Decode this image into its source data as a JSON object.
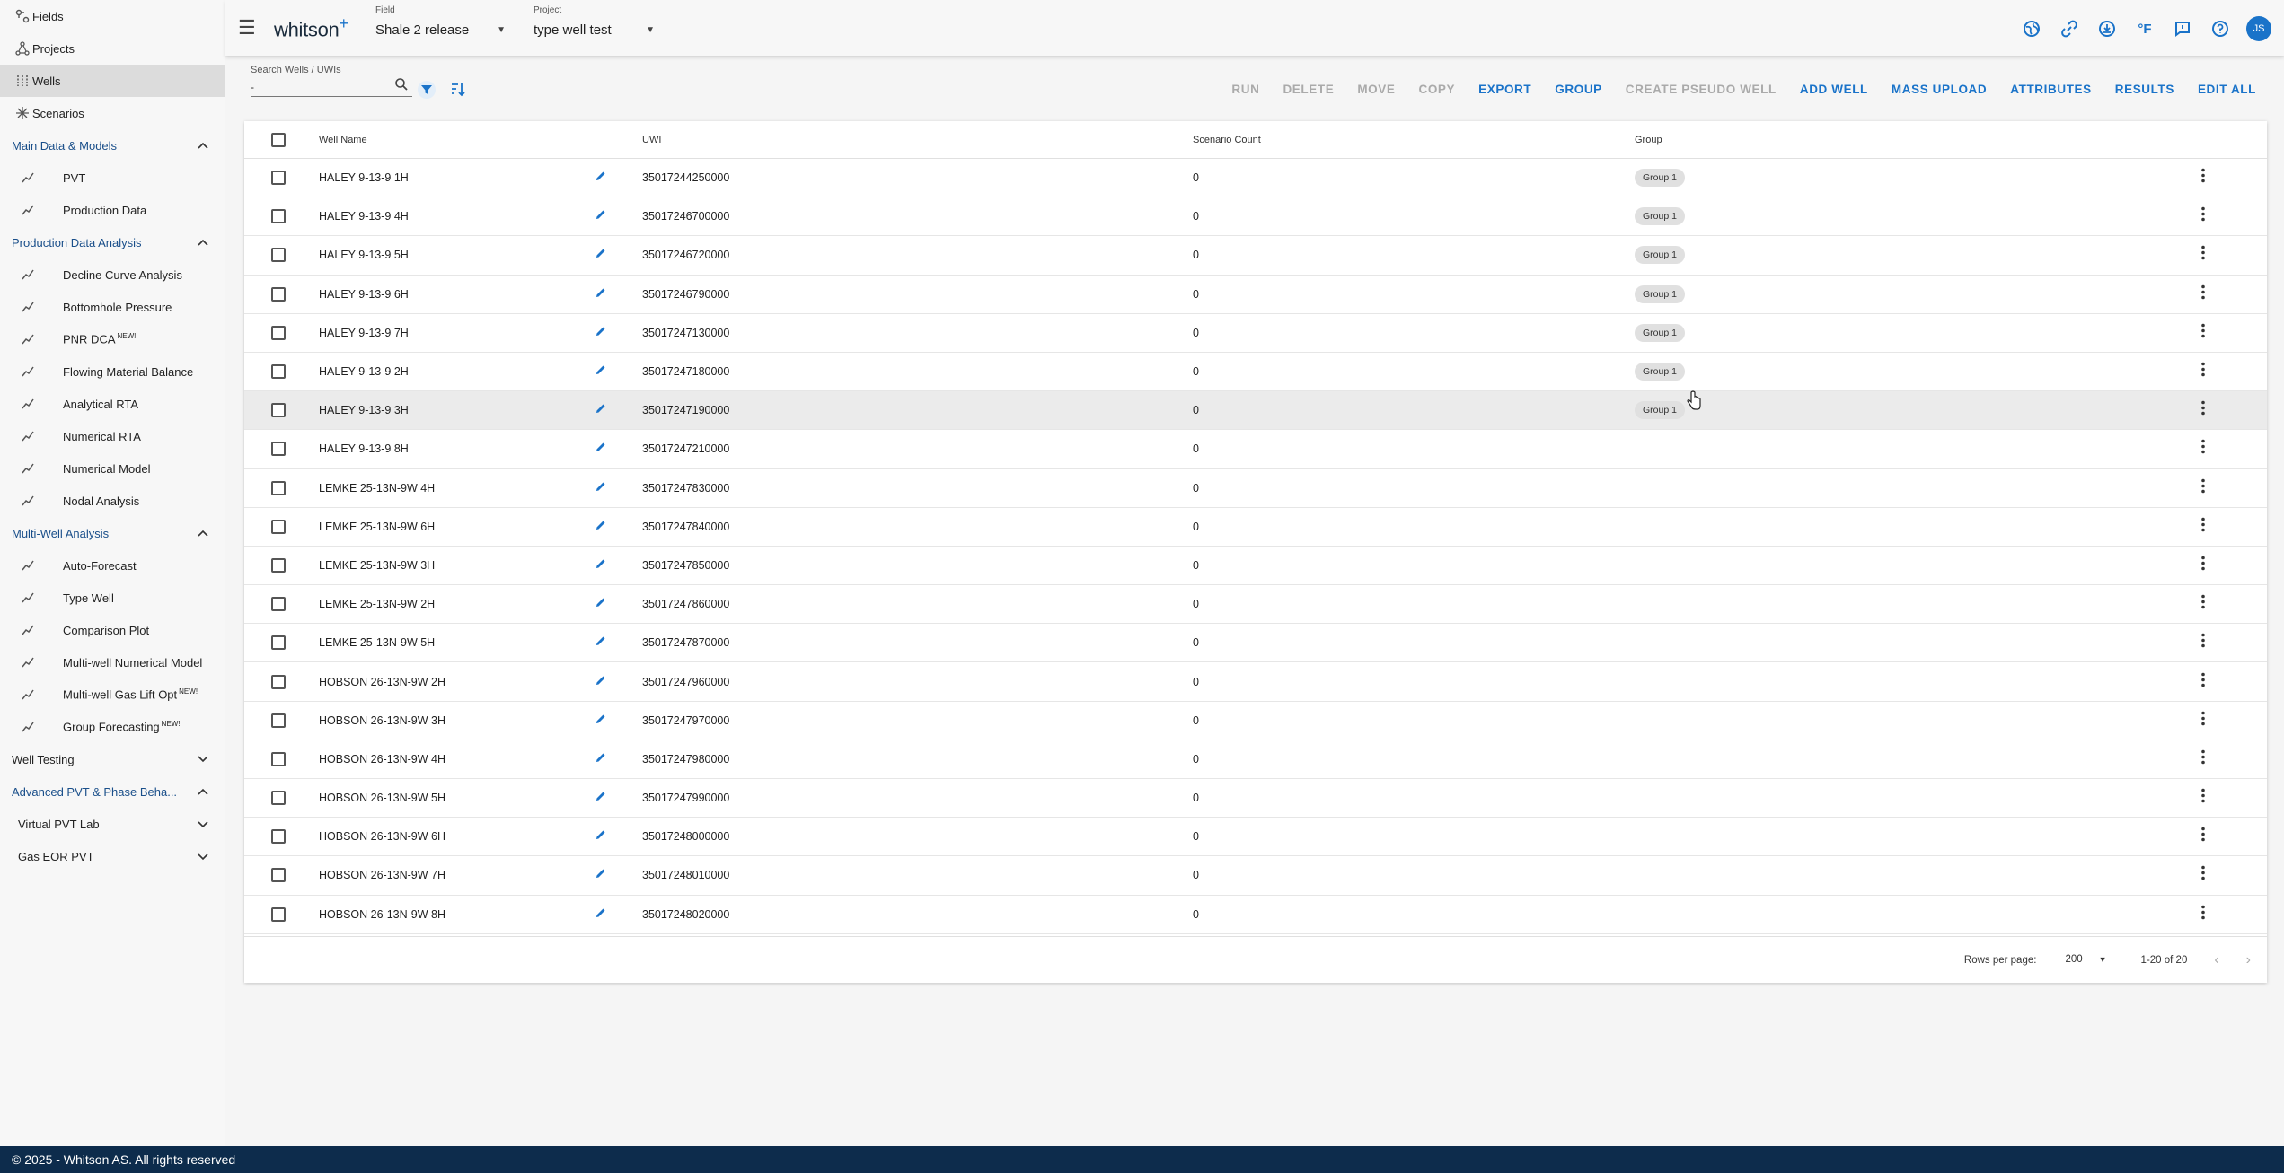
{
  "sidebar": {
    "top_items": [
      {
        "label": "Fields",
        "icon": "fields-icon"
      },
      {
        "label": "Projects",
        "icon": "projects-icon"
      },
      {
        "label": "Wells",
        "icon": "wells-icon",
        "active": true
      },
      {
        "label": "Scenarios",
        "icon": "scenarios-icon"
      }
    ],
    "sections": [
      {
        "title": "Main Data & Models",
        "expanded": true,
        "items": [
          {
            "label": "PVT",
            "new": false
          },
          {
            "label": "Production Data",
            "new": false
          }
        ]
      },
      {
        "title": "Production Data Analysis",
        "expanded": true,
        "items": [
          {
            "label": "Decline Curve Analysis",
            "new": false
          },
          {
            "label": "Bottomhole Pressure",
            "new": false
          },
          {
            "label": "PNR DCA",
            "new": true
          },
          {
            "label": "Flowing Material Balance",
            "new": false
          },
          {
            "label": "Analytical RTA",
            "new": false
          },
          {
            "label": "Numerical RTA",
            "new": false
          },
          {
            "label": "Numerical Model",
            "new": false
          },
          {
            "label": "Nodal Analysis",
            "new": false
          }
        ]
      },
      {
        "title": "Multi-Well Analysis",
        "expanded": true,
        "items": [
          {
            "label": "Auto-Forecast",
            "new": false
          },
          {
            "label": "Type Well",
            "new": false
          },
          {
            "label": "Comparison Plot",
            "new": false
          },
          {
            "label": "Multi-well Numerical Model",
            "new": false
          },
          {
            "label": "Multi-well Gas Lift Opt",
            "new": true
          },
          {
            "label": "Group Forecasting",
            "new": true
          }
        ]
      }
    ],
    "well_testing": "Well Testing",
    "advanced": "Advanced PVT & Phase Beha...",
    "virtual_pvt": "Virtual PVT Lab",
    "gas_eor": "Gas EOR PVT",
    "new_badge": "NEW!"
  },
  "topbar": {
    "logo": "whitson",
    "logo_plus": "+",
    "field_caption": "Field",
    "field_value": "Shale 2 release",
    "project_caption": "Project",
    "project_value": "type well test",
    "avatar": "JS",
    "temp_unit": "°F"
  },
  "toolbar": {
    "search_caption": "Search Wells / UWIs",
    "search_value": "-",
    "actions": [
      {
        "label": "RUN",
        "enabled": false
      },
      {
        "label": "DELETE",
        "enabled": false
      },
      {
        "label": "MOVE",
        "enabled": false
      },
      {
        "label": "COPY",
        "enabled": false
      },
      {
        "label": "EXPORT",
        "enabled": true
      },
      {
        "label": "GROUP",
        "enabled": true
      },
      {
        "label": "CREATE PSEUDO WELL",
        "enabled": false
      },
      {
        "label": "ADD WELL",
        "enabled": true
      },
      {
        "label": "MASS UPLOAD",
        "enabled": true
      },
      {
        "label": "ATTRIBUTES",
        "enabled": true
      },
      {
        "label": "RESULTS",
        "enabled": true
      },
      {
        "label": "EDIT ALL",
        "enabled": true
      }
    ]
  },
  "table": {
    "headers": {
      "name": "Well Name",
      "uwi": "UWI",
      "scenario_count": "Scenario Count",
      "group": "Group"
    },
    "rows": [
      {
        "name": "HALEY 9-13-9 1H",
        "uwi": "35017244250000",
        "count": "0",
        "group": "Group 1"
      },
      {
        "name": "HALEY 9-13-9 4H",
        "uwi": "35017246700000",
        "count": "0",
        "group": "Group 1"
      },
      {
        "name": "HALEY 9-13-9 5H",
        "uwi": "35017246720000",
        "count": "0",
        "group": "Group 1"
      },
      {
        "name": "HALEY 9-13-9 6H",
        "uwi": "35017246790000",
        "count": "0",
        "group": "Group 1"
      },
      {
        "name": "HALEY 9-13-9 7H",
        "uwi": "35017247130000",
        "count": "0",
        "group": "Group 1"
      },
      {
        "name": "HALEY 9-13-9 2H",
        "uwi": "35017247180000",
        "count": "0",
        "group": "Group 1"
      },
      {
        "name": "HALEY 9-13-9 3H",
        "uwi": "35017247190000",
        "count": "0",
        "group": "Group 1",
        "hover": true
      },
      {
        "name": "HALEY 9-13-9 8H",
        "uwi": "35017247210000",
        "count": "0",
        "group": ""
      },
      {
        "name": "LEMKE 25-13N-9W 4H",
        "uwi": "35017247830000",
        "count": "0",
        "group": ""
      },
      {
        "name": "LEMKE 25-13N-9W 6H",
        "uwi": "35017247840000",
        "count": "0",
        "group": ""
      },
      {
        "name": "LEMKE 25-13N-9W 3H",
        "uwi": "35017247850000",
        "count": "0",
        "group": ""
      },
      {
        "name": "LEMKE 25-13N-9W 2H",
        "uwi": "35017247860000",
        "count": "0",
        "group": ""
      },
      {
        "name": "LEMKE 25-13N-9W 5H",
        "uwi": "35017247870000",
        "count": "0",
        "group": ""
      },
      {
        "name": "HOBSON 26-13N-9W 2H",
        "uwi": "35017247960000",
        "count": "0",
        "group": ""
      },
      {
        "name": "HOBSON 26-13N-9W 3H",
        "uwi": "35017247970000",
        "count": "0",
        "group": ""
      },
      {
        "name": "HOBSON 26-13N-9W 4H",
        "uwi": "35017247980000",
        "count": "0",
        "group": ""
      },
      {
        "name": "HOBSON 26-13N-9W 5H",
        "uwi": "35017247990000",
        "count": "0",
        "group": ""
      },
      {
        "name": "HOBSON 26-13N-9W 6H",
        "uwi": "35017248000000",
        "count": "0",
        "group": ""
      },
      {
        "name": "HOBSON 26-13N-9W 7H",
        "uwi": "35017248010000",
        "count": "0",
        "group": ""
      },
      {
        "name": "HOBSON 26-13N-9W 8H",
        "uwi": "35017248020000",
        "count": "0",
        "group": ""
      }
    ],
    "rows_per_page_label": "Rows per page:",
    "rows_per_page": "200",
    "range": "1-20 of 20"
  },
  "footer": {
    "copyright": "© 2025 - Whitson AS. All rights reserved"
  },
  "colors": {
    "accent": "#1a73c9",
    "footer_bg": "#0d2c4c",
    "section_title": "#1a4f8a"
  }
}
